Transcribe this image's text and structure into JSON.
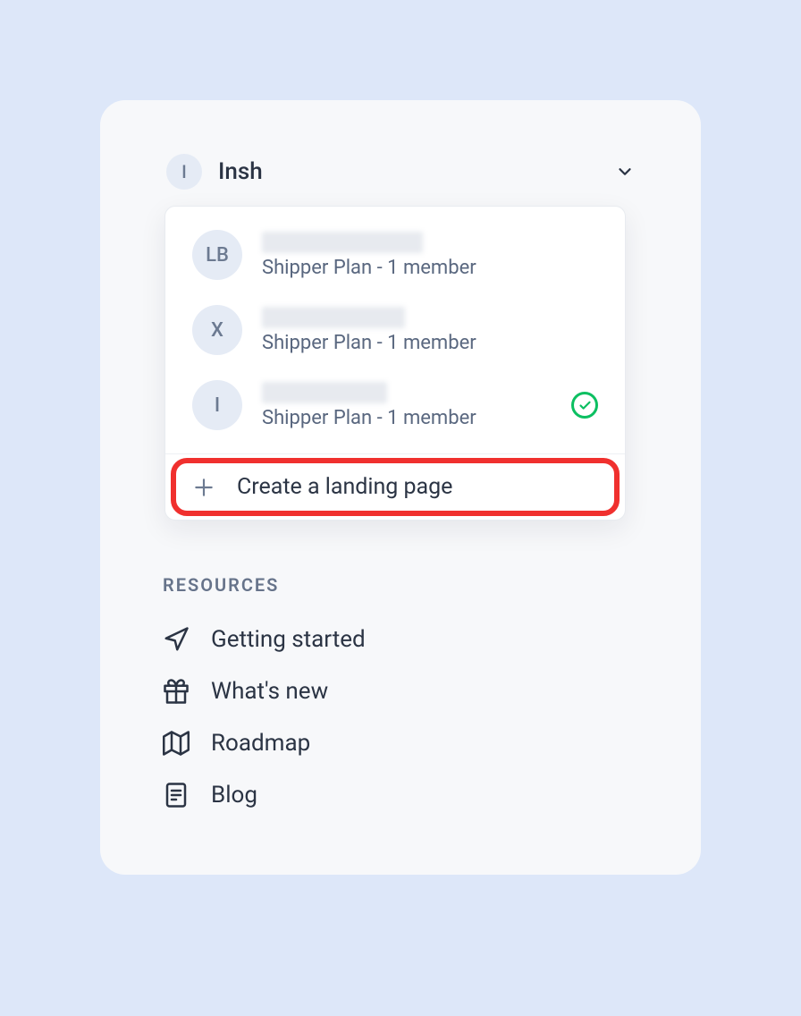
{
  "workspace": {
    "avatar_initial": "I",
    "name": "Insh"
  },
  "dropdown": {
    "items": [
      {
        "avatar": "LB",
        "subtext": "Shipper Plan - 1 member",
        "blur_width": 180,
        "selected": false
      },
      {
        "avatar": "X",
        "subtext": "Shipper Plan - 1 member",
        "blur_width": 160,
        "selected": false
      },
      {
        "avatar": "I",
        "subtext": "Shipper Plan - 1 member",
        "blur_width": 140,
        "selected": true
      }
    ],
    "create_label": "Create a landing page"
  },
  "resources_heading": "RESOURCES",
  "resources": [
    {
      "label": "Getting started"
    },
    {
      "label": "What's new"
    },
    {
      "label": "Roadmap"
    },
    {
      "label": "Blog"
    }
  ]
}
